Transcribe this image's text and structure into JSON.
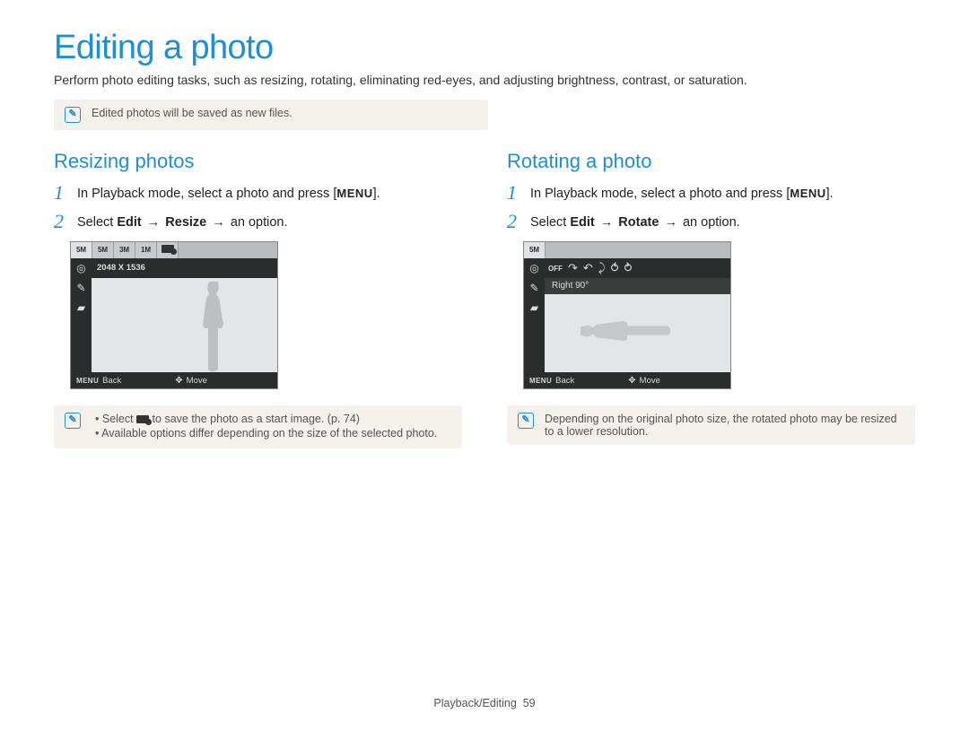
{
  "title": "Editing a photo",
  "intro": "Perform photo editing tasks, such as resizing, rotating, eliminating red-eyes, and adjusting brightness, contrast, or saturation.",
  "top_note": "Edited photos will be saved as new files.",
  "left": {
    "heading": "Resizing photos",
    "step1_num": "1",
    "step1_a": "In Playback mode, select a photo and press [",
    "step1_menu": "MENU",
    "step1_b": "].",
    "step2_num": "2",
    "step2_a": "Select ",
    "step2_edit": "Edit",
    "step2_arrow1": " → ",
    "step2_resize": "Resize",
    "step2_arrow2": " → ",
    "step2_b": "an option.",
    "cam": {
      "tabs": [
        "5M",
        "5M",
        "3M",
        "1M"
      ],
      "size_label": "2048 X 1536",
      "back_menu": "MENU",
      "back_label": "Back",
      "move_label": "Move"
    },
    "note_line1_a": "Select ",
    "note_line1_b": " to save the photo as a start image. (p. 74)",
    "note_line2": "Available options differ depending on the size of the selected photo."
  },
  "right": {
    "heading": "Rotating a photo",
    "step1_num": "1",
    "step1_a": "In Playback mode, select a photo and press [",
    "step1_menu": "MENU",
    "step1_b": "].",
    "step2_num": "2",
    "step2_a": "Select ",
    "step2_edit": "Edit",
    "step2_arrow1": " → ",
    "step2_rotate": "Rotate",
    "step2_arrow2": " → ",
    "step2_b": "an option.",
    "cam": {
      "tab": "5M",
      "opt_label": "Right 90°",
      "back_menu": "MENU",
      "back_label": "Back",
      "move_label": "Move"
    },
    "note": "Depending on the original photo size, the rotated photo may be resized to a lower resolution."
  },
  "footer_section": "Playback/Editing",
  "footer_page": "59"
}
